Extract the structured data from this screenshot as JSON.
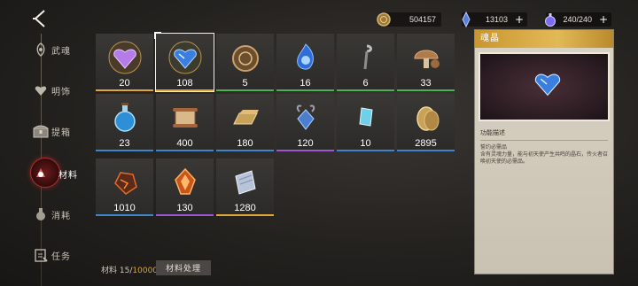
{
  "header": {
    "back_icon": "chevron-left-icon",
    "currencies": [
      {
        "id": "gold",
        "icon": "coin-icon",
        "value": "504157",
        "has_plus": false
      },
      {
        "id": "diamond",
        "icon": "diamond-icon",
        "value": "13103",
        "has_plus": true
      },
      {
        "id": "energy",
        "icon": "energy-potion-icon",
        "value": "240/240",
        "has_plus": true
      }
    ],
    "plus_label": "+"
  },
  "sidebar": {
    "items": [
      {
        "label": "武魂",
        "icon": "spirit-icon",
        "active": false
      },
      {
        "label": "明饰",
        "icon": "ornament-icon",
        "active": false
      },
      {
        "label": "提箱",
        "icon": "chest-icon",
        "active": false
      },
      {
        "label": "材料",
        "icon": "material-icon",
        "active": true
      },
      {
        "label": "消耗",
        "icon": "consumable-icon",
        "active": false
      },
      {
        "label": "任务",
        "icon": "quest-icon",
        "active": false
      }
    ]
  },
  "inventory": {
    "items": [
      {
        "name": "purple-heart-gem",
        "qty": "20",
        "rarity": "gold"
      },
      {
        "name": "soul-crystal",
        "qty": "108",
        "rarity": "gold",
        "selected": true
      },
      {
        "name": "bronze-medallion",
        "qty": "5",
        "rarity": "green"
      },
      {
        "name": "blue-flame-soul",
        "qty": "16",
        "rarity": "green"
      },
      {
        "name": "iron-nail",
        "qty": "6",
        "rarity": "green"
      },
      {
        "name": "mushroom",
        "qty": "33",
        "rarity": "green"
      },
      {
        "name": "blue-potion",
        "qty": "23",
        "rarity": "blue"
      },
      {
        "name": "scroll",
        "qty": "400",
        "rarity": "blue"
      },
      {
        "name": "gold-ingot",
        "qty": "180",
        "rarity": "blue"
      },
      {
        "name": "tentacle-crystal",
        "qty": "120",
        "rarity": "purple"
      },
      {
        "name": "ice-shard",
        "qty": "10",
        "rarity": "blue"
      },
      {
        "name": "gold-coins",
        "qty": "2895",
        "rarity": "blue"
      },
      {
        "name": "magma-ore",
        "qty": "1010",
        "rarity": "blue"
      },
      {
        "name": "fire-crystal",
        "qty": "130",
        "rarity": "purple"
      },
      {
        "name": "paper-stack",
        "qty": "1280",
        "rarity": "gold"
      }
    ],
    "rarity_colors": {
      "gold": "#e0a63c",
      "green": "#4fae57",
      "blue": "#3f86c8",
      "purple": "#9b57d1"
    }
  },
  "footer": {
    "count_label": "材料",
    "count_current": "15",
    "count_sep": "/",
    "count_capacity": "10000",
    "process_button": "材料处理"
  },
  "detail": {
    "title": "魂晶",
    "section_label": "功能描述",
    "description": "誓约必需品\n含有灵魂力量，能与初天使产生共鸣的晶石，传火者召唤初天使的必需品。"
  }
}
